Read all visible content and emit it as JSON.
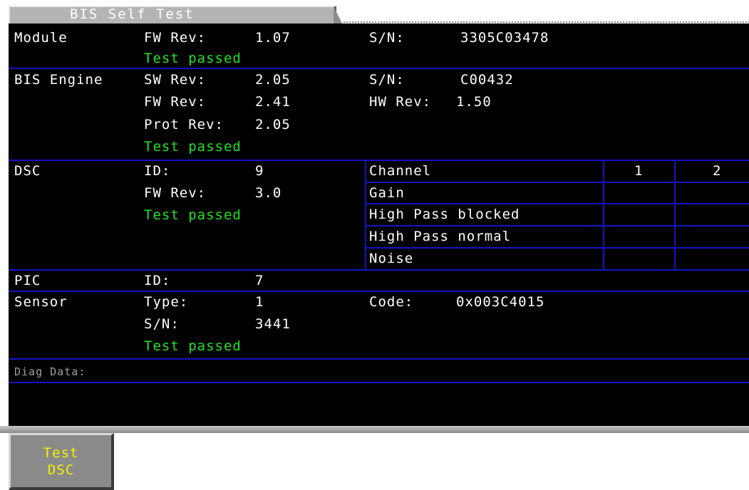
{
  "window": {
    "title": "BIS Self Test"
  },
  "module": {
    "label": "Module",
    "fw_rev_label": "FW Rev:",
    "fw_rev": "1.07",
    "sn_label": "S/N:",
    "sn": "3305C03478",
    "status": "Test passed"
  },
  "engine": {
    "label": "BIS Engine",
    "sw_rev_label": "SW Rev:",
    "sw_rev": "2.05",
    "fw_rev_label": "FW Rev:",
    "fw_rev": "2.41",
    "prot_rev_label": "Prot Rev:",
    "prot_rev": "2.05",
    "sn_label": "S/N:",
    "sn": "C00432",
    "hw_rev_label": "HW Rev:",
    "hw_rev": "1.50",
    "status": "Test passed"
  },
  "dsc": {
    "label": "DSC",
    "id_label": "ID:",
    "id": "9",
    "fw_rev_label": "FW Rev:",
    "fw_rev": "3.0",
    "status": "Test passed",
    "table": {
      "header": "Channel",
      "col1": "1",
      "col2": "2",
      "rows": [
        "Gain",
        "High Pass blocked",
        "High Pass normal",
        "Noise"
      ]
    }
  },
  "pic": {
    "label": "PIC",
    "id_label": "ID:",
    "id": "7"
  },
  "sensor": {
    "label": "Sensor",
    "type_label": "Type:",
    "type": "1",
    "sn_label": "S/N:",
    "sn": "3441",
    "code_label": "Code:",
    "code": "0x003C4015",
    "status": "Test passed"
  },
  "diag": {
    "label": "Diag Data:"
  },
  "buttons": {
    "test_dsc_line1": "Test",
    "test_dsc_line2": "DSC"
  },
  "colors": {
    "background": "#000000",
    "text": "#ffffff",
    "pass": "#1ee61e",
    "grid": "#1414c8",
    "button_text": "#f2f200",
    "button_bg": "#8a8a8a"
  }
}
